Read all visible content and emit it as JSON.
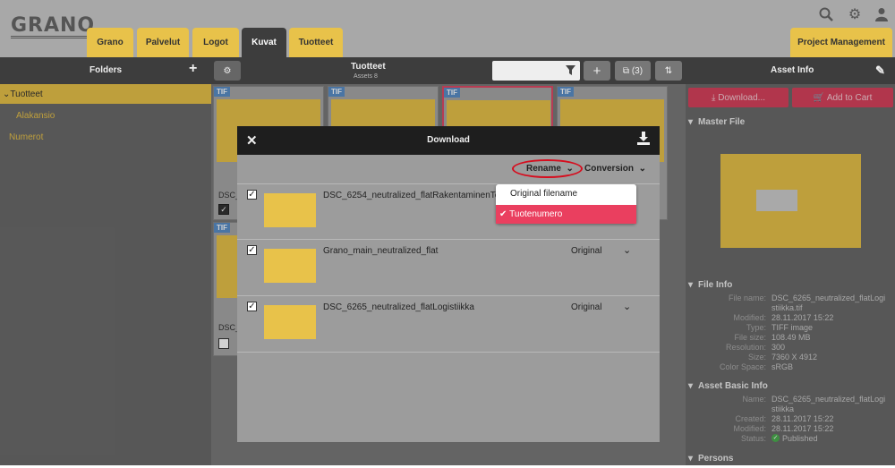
{
  "header": {
    "logo": "GRANO",
    "tabs": [
      "Grano",
      "Palvelut",
      "Logot",
      "Kuvat",
      "Tuotteet"
    ],
    "active_tab": "Kuvat",
    "project": "Project Management"
  },
  "toolbar": {
    "folders": "Folders",
    "title": "Tuotteet",
    "subtitle": "Assets 8",
    "compare_count": "(3)",
    "asset_info": "Asset Info"
  },
  "sidebar": {
    "items": [
      "Tuotteet",
      "Alakansio",
      "Numerot"
    ]
  },
  "grid": {
    "tif": "TIF",
    "card_label_a": "DSC_",
    "card_label_b": "DSC_"
  },
  "right": {
    "download": "Download...",
    "cart": "Add to Cart",
    "master": "Master File",
    "file_info": "File Info",
    "rows": [
      {
        "k": "File name:",
        "v": "DSC_6265_neutralized_flatLogi"
      },
      {
        "k": "",
        "v": "stiikka.tif"
      },
      {
        "k": "Modified:",
        "v": "28.11.2017 15:22"
      },
      {
        "k": "Type:",
        "v": "TIFF image"
      },
      {
        "k": "File size:",
        "v": "108.49 MB"
      },
      {
        "k": "Resolution:",
        "v": "300"
      },
      {
        "k": "Size:",
        "v": "7360 X 4912"
      },
      {
        "k": "Color Space:",
        "v": "sRGB"
      }
    ],
    "basic": "Asset Basic Info",
    "basic_rows": [
      {
        "k": "Name:",
        "v": "DSC_6265_neutralized_flatLogi"
      },
      {
        "k": "",
        "v": "stiikka"
      },
      {
        "k": "Created:",
        "v": "28.11.2017 15:22"
      },
      {
        "k": "Modified:",
        "v": "28.11.2017 15:22"
      },
      {
        "k": "Status:",
        "v": "Published"
      }
    ],
    "persons": "Persons"
  },
  "modal": {
    "title": "Download",
    "rename": "Rename",
    "conversion": "Conversion",
    "files": [
      {
        "name": "DSC_6254_neutralized_flatRakentaminenTeol",
        "conv": ""
      },
      {
        "name": "Grano_main_neutralized_flat",
        "conv": "Original"
      },
      {
        "name": "DSC_6265_neutralized_flatLogistiikka",
        "conv": "Original"
      }
    ],
    "options": [
      "Original filename",
      "Tuotenumero"
    ],
    "selected_option": "Tuotenumero"
  }
}
